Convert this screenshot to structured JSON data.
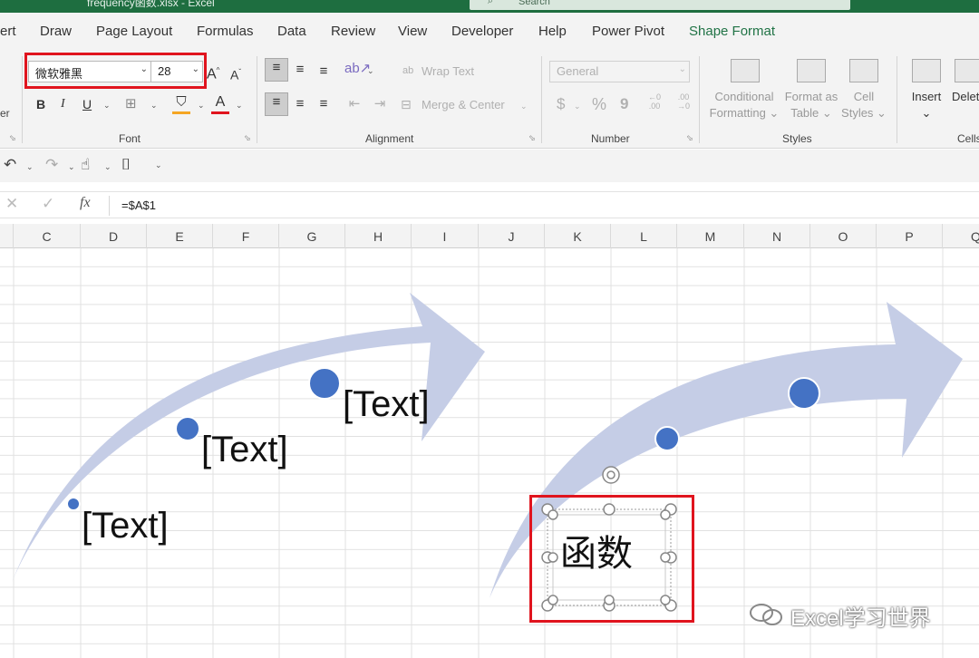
{
  "window": {
    "title": "frequency函数.xlsx - Excel",
    "search_placeholder": "Search"
  },
  "tabs": [
    {
      "label": "ert",
      "active": false
    },
    {
      "label": "Draw",
      "active": false
    },
    {
      "label": "Page Layout",
      "active": false
    },
    {
      "label": "Formulas",
      "active": false
    },
    {
      "label": "Data",
      "active": false
    },
    {
      "label": "Review",
      "active": false
    },
    {
      "label": "View",
      "active": false
    },
    {
      "label": "Developer",
      "active": false
    },
    {
      "label": "Help",
      "active": false
    },
    {
      "label": "Power Pivot",
      "active": false
    },
    {
      "label": "Shape Format",
      "active": true
    }
  ],
  "ribbon": {
    "clipboard_stub": "er",
    "font": {
      "name": "微软雅黑",
      "size": "28",
      "grow": "A",
      "shrink": "A",
      "bold": "B",
      "italic": "I",
      "underline": "U",
      "font_color_letter": "A",
      "group_label": "Font"
    },
    "alignment": {
      "wrap_text": "Wrap Text",
      "merge_center": "Merge & Center",
      "group_label": "Alignment"
    },
    "number": {
      "format": "General",
      "currency": "$",
      "percent": "%",
      "comma": "9",
      "inc_decimal": "←0 .00",
      "dec_decimal": ".00 →0",
      "group_label": "Number"
    },
    "styles": {
      "conditional": "Conditional",
      "conditional2": "Formatting",
      "format_as": "Format as",
      "format_as2": "Table",
      "cell": "Cell",
      "cell2": "Styles",
      "group_label": "Styles"
    },
    "cells": {
      "insert": "Insert",
      "delete": "Delet",
      "group_label": "Cells"
    }
  },
  "formula_bar": {
    "cancel": "✕",
    "enter": "✓",
    "fx": "fx",
    "formula": "=$A$1"
  },
  "columns": [
    "C",
    "D",
    "E",
    "F",
    "G",
    "H",
    "I",
    "J",
    "K",
    "L",
    "M",
    "N",
    "O",
    "P",
    "Q"
  ],
  "shapes": {
    "labels": [
      "[Text]",
      "[Text]",
      "[Text]"
    ],
    "selected_text": "函数"
  },
  "colors": {
    "excel_green": "#217346",
    "arrow": "#c5cde6",
    "dot": "#4472c4",
    "highlight": "#e0141e"
  },
  "watermark": "Excel学习世界"
}
